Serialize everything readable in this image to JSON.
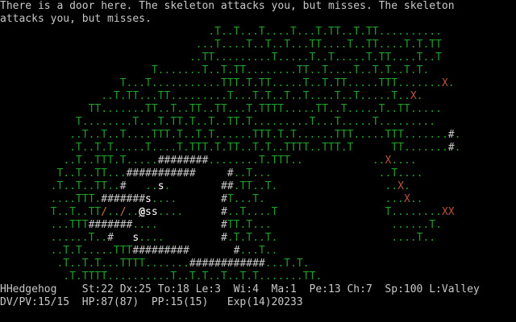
{
  "messages": [
    "There is a door here. The skeleton attacks you, but misses. The skeleton",
    "attacks you, but misses."
  ],
  "map_rows": [
    "                                 .T..T...T....T...T.TT..T.TT..........",
    "                               ...T....T..T..T...TT....T..TT....T.T.TT",
    "                              ..TT.........T.....T..T.....T.TT....T..T",
    "                        T.......T..T.TT........TT..T....T..T.T..T.T.",
    "                   T...T...........TTT.T.TT.....T..T.TT.....TTT.......X.",
    "                ..T.TT...TT.........T...T.T..T..T....T..T.....T..X.",
    "              TT.......TT..T..TT..TT...T.TTTT.....TT..T.....T..TT.....",
    "            T........T...T.TT.T..T..TT.T.........T...T.....T.........",
    "           ..T..T..T....TTT.T..T.T......TTT.T.T......TTT.....TTT.......#.",
    "           .T..T.T.....T....T.TTT.T.TT..T.T..TTTT..TTT.T      TT.......#.",
    "          ..T..TTT.T.....########........T.TTT..           ..X....",
    "         T..T..TT...###########     #..T...                 ..T....",
    "        .T..T..TT..#   ..s.        ##.TT..T.                 ..X.",
    "        ....TTT.#######s....       #T...T.                   ...X..",
    "        T..T..TT/../..@ss....      #..T....T                 T........XX",
    "        ...TTT#######....          #TT.T...                   ......T.",
    "        ......T..#   s....         #.T.T..T.                  ....T..",
    "        ..T.T.....TTT#########       #...T..",
    "         .T..T.T...TTTT.......############...T.T.",
    "          .T.TTTT..........T..T.T..T..T.T.......TT."
  ],
  "status": {
    "line1": "HHedgehog    St:22 Dx:25 To:18 Le:3  Wi:4  Ma:1  Pe:13 Ch:7  Sp:100 L:Valley",
    "line2": "DV/PV:15/15  HP:87(87)  PP:15(15)   Exp(14)20233"
  },
  "colors": {
    "tree": "#1f9d2a",
    "wall": "#c8c8c8",
    "trap": "#b5533a",
    "text": "#c8c8c8",
    "background": "#000000"
  },
  "legend": {
    "T": "tree",
    ".": "grass",
    "#": "wall",
    "X": "trap",
    "/": "door",
    "s": "skeleton",
    "@": "player"
  }
}
